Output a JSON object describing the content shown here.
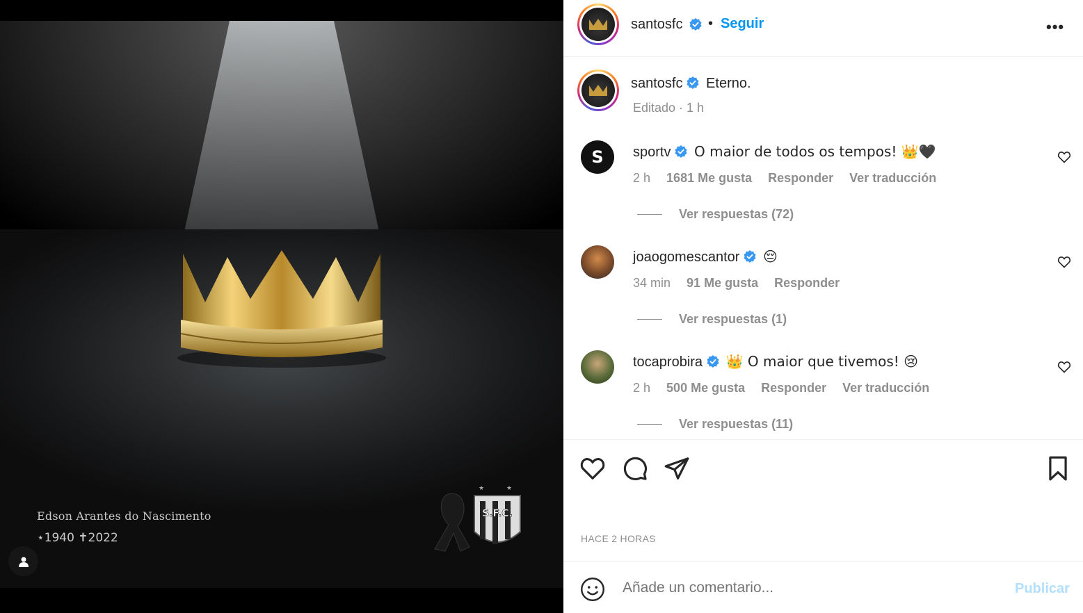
{
  "post": {
    "caption_name": "Edson Arantes do Nascimento",
    "caption_years": "⋆1940  ✝2022",
    "logo_text": "S.F.C."
  },
  "header": {
    "username": "santosfc",
    "separator": "•",
    "follow_label": "Seguir",
    "more_label": "•••"
  },
  "caption": {
    "username": "santosfc",
    "text": "Eterno.",
    "meta": "Editado · 1 h"
  },
  "comments": [
    {
      "username": "sportv",
      "text": "O maior de todos os tempos! 👑🖤",
      "time": "2 h",
      "likes": "1681 Me gusta",
      "reply": "Responder",
      "translate": "Ver traducción",
      "view_replies": "Ver respuestas (72)"
    },
    {
      "username": "joaogomescantor",
      "text": "😔",
      "time": "34 min",
      "likes": "91 Me gusta",
      "reply": "Responder",
      "translate": "",
      "view_replies": "Ver respuestas (1)"
    },
    {
      "username": "tocaprobira",
      "text": "👑 O maior que tivemos! 😢",
      "time": "2 h",
      "likes": "500 Me gusta",
      "reply": "Responder",
      "translate": "Ver traducción",
      "view_replies": "Ver respuestas (11)"
    }
  ],
  "footer": {
    "time_ago": "HACE 2 HORAS",
    "comment_placeholder": "Añade un comentario...",
    "publish_label": "Publicar"
  },
  "colors": {
    "accent": "#0095f6",
    "verified": "#3897f0",
    "muted": "#8e8e8e",
    "publish_disabled": "#b2dffc"
  }
}
